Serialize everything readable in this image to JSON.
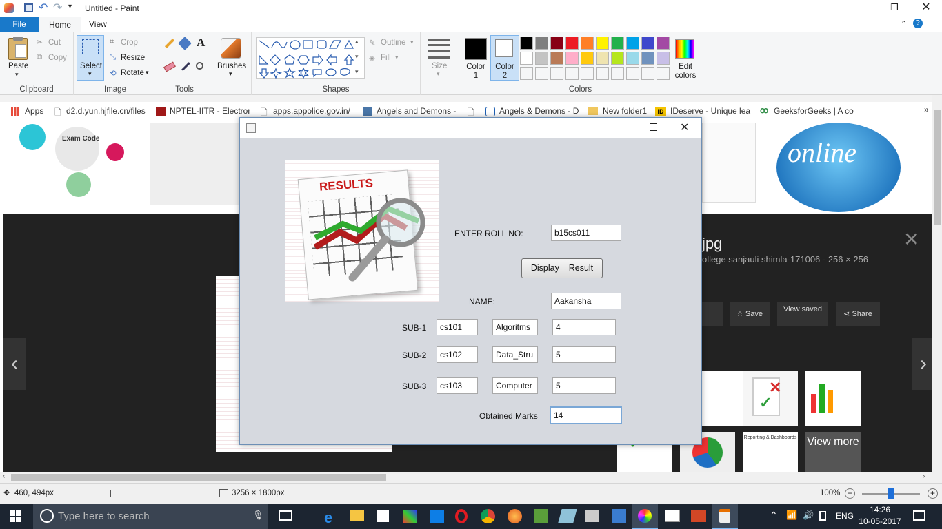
{
  "window": {
    "title": "Untitled - Paint"
  },
  "ribbon_tabs": [
    "File",
    "Home",
    "View"
  ],
  "clipboard": {
    "paste": "Paste",
    "cut": "Cut",
    "copy": "Copy",
    "group": "Clipboard"
  },
  "image": {
    "select": "Select",
    "crop": "Crop",
    "resize": "Resize",
    "rotate": "Rotate",
    "group": "Image"
  },
  "tools": {
    "group": "Tools"
  },
  "brushes": {
    "label": "Brushes"
  },
  "shapes": {
    "outline": "Outline",
    "fill": "Fill",
    "group": "Shapes"
  },
  "size": {
    "label": "Size"
  },
  "colors": {
    "color1": "Color 1",
    "color2": "Color 2",
    "edit": "Edit colors",
    "group": "Colors",
    "color1_value": "#000000",
    "color2_value": "#ffffff",
    "palette_row1": [
      "#000000",
      "#7f7f7f",
      "#880015",
      "#ed1c24",
      "#ff7f27",
      "#fff200",
      "#22b14c",
      "#00a2e8",
      "#3f48cc",
      "#a349a4"
    ],
    "palette_row2": [
      "#ffffff",
      "#c3c3c3",
      "#b97a57",
      "#ffaec9",
      "#ffc90e",
      "#efe4b0",
      "#b5e61d",
      "#99d9ea",
      "#7092be",
      "#c8bfe7"
    ]
  },
  "bookmarks": [
    "Apps",
    "d2.d.yun.hjfile.cn/files",
    "NPTEL-IITR - Electron",
    "apps.appolice.gov.in/",
    "Angels and Demons -",
    "Angels & Demons - D",
    "New folder1",
    "IDeserve - Unique lea",
    "GeeksforGeeks | A co"
  ],
  "background_page": {
    "exam_code": "Exam Code",
    "image_title": "jpg",
    "image_subtitle": "ollege sanjauli shimla-171006 - 256 × 256",
    "save": "Save",
    "view_saved": "View saved",
    "share": "Share",
    "view_more": "View more",
    "reporting": "Reporting & Dashboards",
    "results_word": "RESULTS"
  },
  "app": {
    "roll_label": "ENTER  ROLL NO:",
    "roll_value": "b15cs011",
    "display_button": "Display    Result",
    "name_label": "NAME:",
    "name_value": "Aakansha",
    "subjects": [
      {
        "label": "SUB-1",
        "code": "cs101",
        "name": "Algoritms",
        "marks": "4"
      },
      {
        "label": "SUB-2",
        "code": "cs102",
        "name": "Data_Stru",
        "marks": "5"
      },
      {
        "label": "SUB-3",
        "code": "cs103",
        "name": "Computer",
        "marks": "5"
      }
    ],
    "obtained_label": "Obtained Marks",
    "obtained_value": "14"
  },
  "status": {
    "cursor": "460, 494px",
    "size": "3256 × 1800px",
    "zoom": "100%"
  },
  "taskbar": {
    "search_placeholder": "Type here to search",
    "lang": "ENG",
    "time": "14:26",
    "date": "10-05-2017"
  }
}
